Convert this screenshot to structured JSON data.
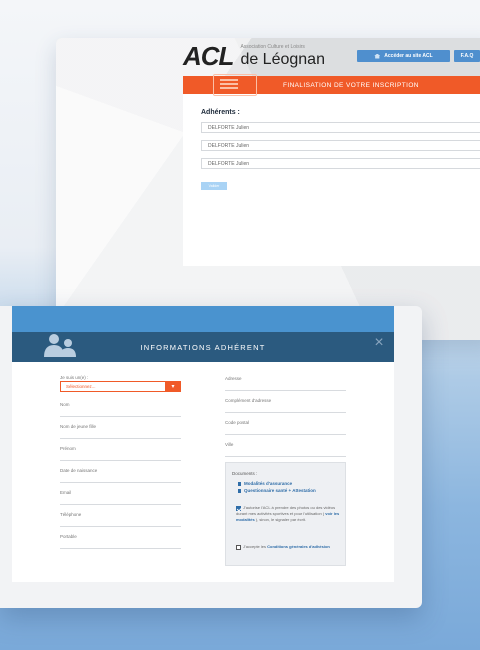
{
  "site": {
    "logo_main": "ACL",
    "logo_small": "Association Culture et Loisirs",
    "logo_city": "de Léognan",
    "btn_access": "Accéder au site ACL",
    "btn_faq": "F.A.Q",
    "banner": "FINALISATION DE VOTRE INSCRIPTION",
    "adherents_title": "Adhérents :",
    "adherents": [
      "DELFORTE Julien",
      "DELFORTE Julien",
      "DELFORTE Julien"
    ],
    "submit": "Valider"
  },
  "modal": {
    "title": "INFORMATIONS ADHÉRENT",
    "select_label": "Je suis un(e) :",
    "select_value": "Sélectionnez...",
    "left_fields": [
      "Nom",
      "Nom de jeune fille",
      "Prénom",
      "Date de naissance",
      "Email",
      "Téléphone",
      "Portable"
    ],
    "right_fields": [
      "Adresse",
      "Complément d'adresse",
      "Code postal",
      "Ville"
    ],
    "documents": {
      "title": "Documents :",
      "links": [
        "Modalités d'assurance",
        "Questionnaire santé + Attestation"
      ]
    },
    "consent_photo_pre": "J'autorise l'ACL à prendre des photos ou des vidéos durant mes activités sportives et pour l'utilisation ( ",
    "consent_photo_link": "voir les modalités",
    "consent_photo_post": " ), sinon, le signaler par écrit.",
    "consent_cg_pre": "J'accepte les ",
    "consent_cg_link": "Conditions générales d'adhésion",
    "colors": {
      "accent": "#f05a28",
      "blue": "#4a93cf",
      "navy": "#2b5a7f"
    }
  }
}
